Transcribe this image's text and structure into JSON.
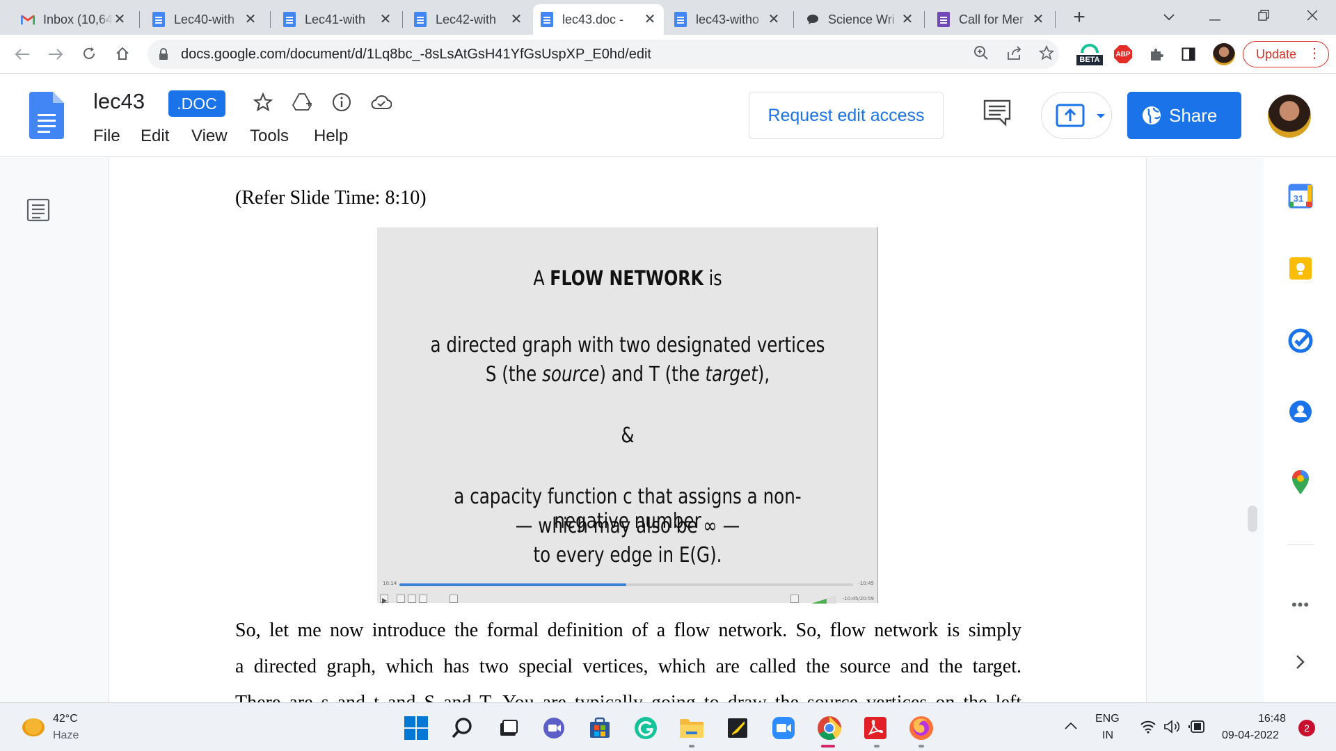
{
  "browser": {
    "tabs": [
      {
        "title": "Inbox (10,64",
        "icon": "gmail-icon"
      },
      {
        "title": "Lec40-with",
        "icon": "docs-icon"
      },
      {
        "title": "Lec41-with",
        "icon": "docs-icon"
      },
      {
        "title": "Lec42-with",
        "icon": "docs-icon"
      },
      {
        "title": "lec43.doc -",
        "icon": "docs-icon"
      },
      {
        "title": "lec43-witho",
        "icon": "docs-icon"
      },
      {
        "title": "Science Wri",
        "icon": "chat-icon"
      },
      {
        "title": "Call for Mer",
        "icon": "forms-icon"
      }
    ],
    "new_tab": "+",
    "close_glyph": "✕",
    "url": "docs.google.com/document/d/1Lq8bc_-8sLsAtGsH41YfGsUspXP_E0hd/edit",
    "beta_label": "BETA",
    "abp_label": "ABP",
    "update_label": "Update"
  },
  "docs": {
    "title": "lec43",
    "badge": ".DOC",
    "menu": [
      "File",
      "Edit",
      "View",
      "Tools",
      "Help"
    ],
    "request_edit": "Request edit access",
    "share": "Share"
  },
  "document": {
    "refer": "(Refer Slide Time: 8:10)",
    "para1": "So, let me now introduce the formal definition of a flow network. So, flow network is simply",
    "para2": "a directed graph, which has two special vertices, which are called the source and the target.",
    "para3": "There are s and t and S and T. You are typically going to draw the source vertices on the left"
  },
  "slide": {
    "title_prefix": "A",
    "title_bold": "FLOW NETWORK",
    "title_suffix": "is",
    "line1": "a directed graph with two designated vertices",
    "line2_a": "S (the ",
    "line2_b": "source",
    "line2_c": ") and T (the ",
    "line2_d": "target",
    "line2_e": "),",
    "amp": "&",
    "line4": "a capacity function c that assigns a non-negative number",
    "line5": "— which may also be ∞ —",
    "line6": "to every edge in E(G).",
    "player_elapsed": "10:14",
    "player_remaining": "-10:45",
    "player_duration": "-10:45/20:59",
    "progress": 0.5
  },
  "taskbar": {
    "temp": "42°C",
    "weather": "Haze",
    "lang1": "ENG",
    "lang2": "IN",
    "time": "16:48",
    "date": "09-04-2022",
    "notifications": "2"
  }
}
